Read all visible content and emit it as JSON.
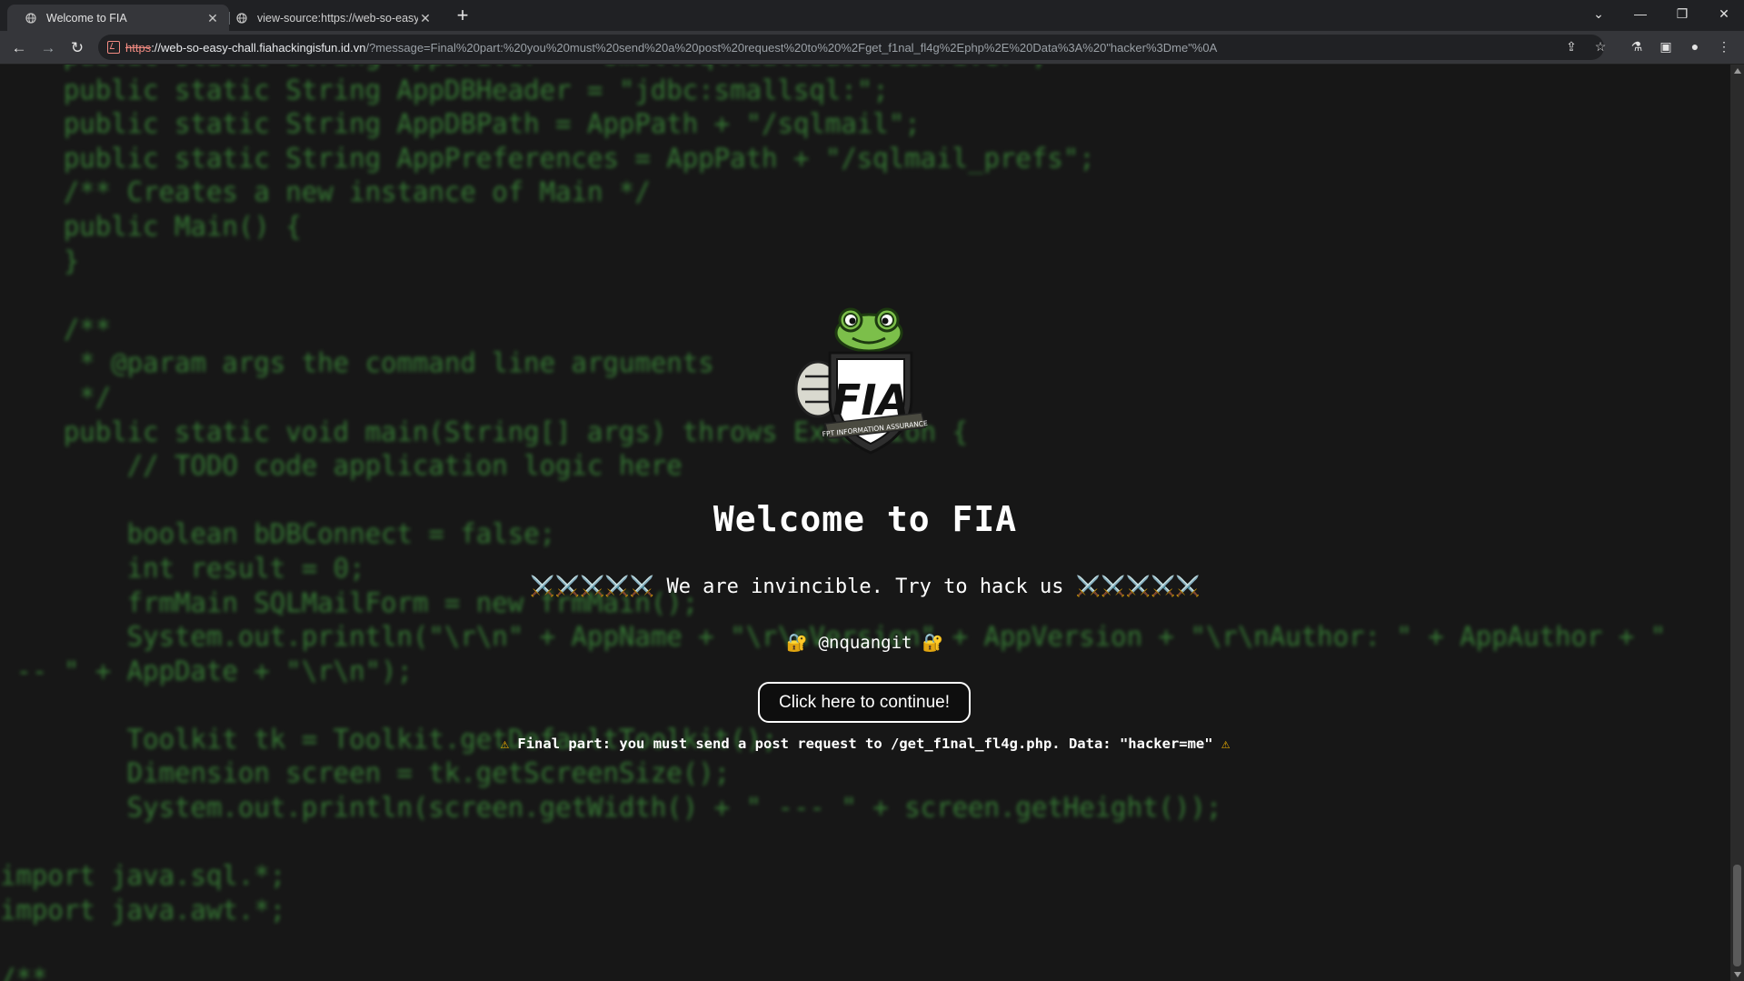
{
  "browser": {
    "tabs": [
      {
        "title": "Welcome to FIA",
        "close": "✕"
      },
      {
        "title": "view-source:https://web-so-easy",
        "close": "✕"
      }
    ],
    "new_tab": "+",
    "window": {
      "tab_search": "⌄",
      "minimize": "—",
      "maximize": "❐",
      "close": "✕"
    },
    "nav": {
      "back": "←",
      "forward": "→",
      "reload": "↻"
    },
    "url": {
      "scheme": "https",
      "host": "://web-so-easy-chall.fiahackingisfun.id.vn",
      "rest": "/?message=Final%20part:%20you%20must%20send%20a%20post%20request%20to%20%2Fget_f1nal_fl4g%2Ephp%2E%20Data%3A%20\"hacker%3Dme\"%0A"
    },
    "icons": {
      "share": "⇪",
      "star": "☆",
      "labs": "⚗",
      "sidepanel": "▣",
      "profile": "●",
      "menu": "⋮"
    },
    "colors": {
      "tabstrip": "#202124",
      "toolbar": "#35363a",
      "omnibox": "#202124",
      "not_secure": "#f28b82"
    }
  },
  "page": {
    "background_code": "    public static String AppDriver = \"smallsql.database.SSDriver\";\n    public static String AppDBHeader = \"jdbc:smallsql:\";\n    public static String AppDBPath = AppPath + \"/sqlmail\";\n    public static String AppPreferences = AppPath + \"/sqlmail_prefs\";\n    /** Creates a new instance of Main */\n    public Main() {\n    }\n\n    /**\n     * @param args the command line arguments\n     */\n    public static void main(String[] args) throws Exception {\n        // TODO code application logic here\n\n        boolean bDBConnect = false;\n        int result = 0;\n        frmMain SQLMailForm = new frmMain();\n        System.out.println(\"\\r\\n\" + AppName + \"\\r\\nVersion\" + AppVersion + \"\\r\\nAuthor: \" + AppAuthor + \"\n -- \" + AppDate + \"\\r\\n\");\n\n        Toolkit tk = Toolkit.getDefaultToolkit();\n        Dimension screen = tk.getScreenSize();\n        System.out.println(screen.getWidth() + \" --- \" + screen.getHeight());\n\nimport java.sql.*;\nimport java.awt.*;\n\n/**",
    "logo": {
      "text": "FIA",
      "ribbon": "FPT INFORMATION ASSURANCE"
    },
    "heading": "Welcome to FIA",
    "tagline": "⚔️⚔️⚔️⚔️⚔️ We are invincible. Try to hack us ⚔️⚔️⚔️⚔️⚔️",
    "author": "🔐 @nquangit 🔐",
    "continue_button": "Click here to continue!",
    "final_note": {
      "icon": "⚠",
      "text": " Final part: you must send a post request to /get_f1nal_fl4g.php. Data: \"hacker=me\" "
    },
    "colors": {
      "background": "#171717",
      "code": "#3c8a3a",
      "text": "#ffffff",
      "warning": "#f4b400"
    }
  }
}
